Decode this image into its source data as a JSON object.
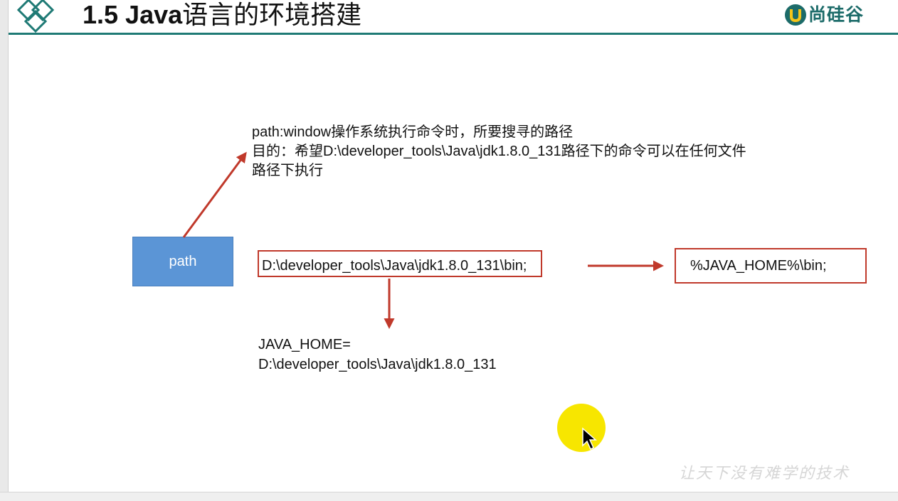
{
  "header": {
    "title_prefix": "1.5 Java",
    "title_suffix": "语言的环境搭建",
    "brand": "尚硅谷",
    "logo_icon": "diamond-logo-icon",
    "brand_icon": "u-brand-icon",
    "accent_color": "#1f7a75"
  },
  "note": {
    "line1": "path:window操作系统执行命令时，所要搜寻的路径",
    "line2": "目的：希望D:\\developer_tools\\Java\\jdk1.8.0_131路径下的命令可以在任何文件",
    "line3": "路径下执行"
  },
  "path_box": {
    "label": "path",
    "color": "#5b95d6"
  },
  "path_value": "D:\\developer_tools\\Java\\jdk1.8.0_131\\bin;",
  "java_home_path": "%JAVA_HOME%\\bin;",
  "java_home_def": {
    "line1": "JAVA_HOME=",
    "line2": "D:\\developer_tools\\Java\\jdk1.8.0_131"
  },
  "arrow_color": "#c0392b",
  "highlight_color": "#f7e600",
  "watermark": "让天下没有难学的技术"
}
